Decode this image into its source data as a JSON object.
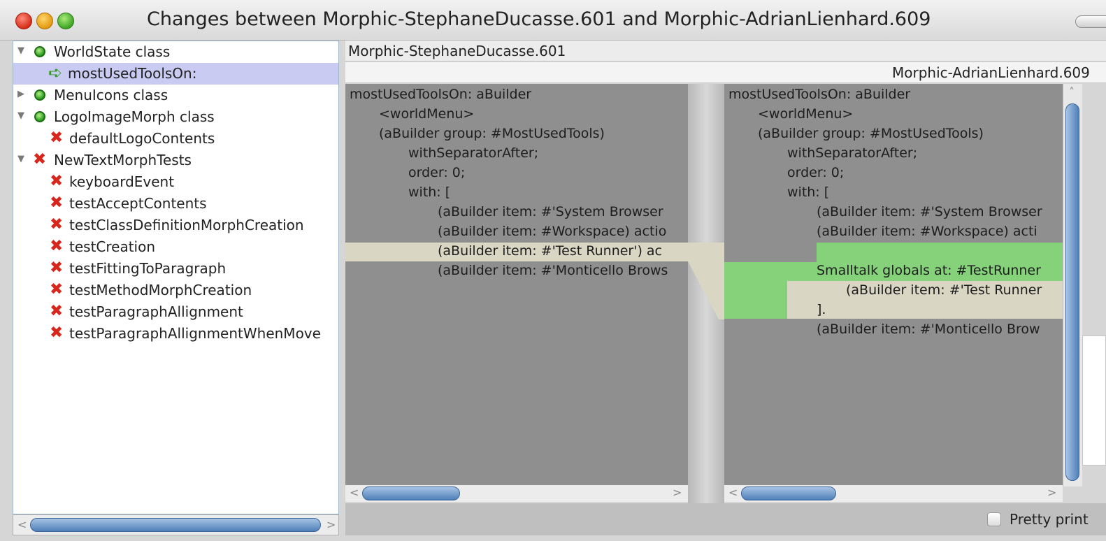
{
  "window": {
    "title": "Changes between Morphic-StephaneDucasse.601 and Morphic-AdrianLienhard.609"
  },
  "tree": {
    "items": [
      {
        "label": "WorldState class",
        "status": "ok",
        "expanded": true
      },
      {
        "label": "mostUsedToolsOn:",
        "status": "changed",
        "selected": true
      },
      {
        "label": "MenuIcons class",
        "status": "ok",
        "expanded": false
      },
      {
        "label": "LogoImageMorph class",
        "status": "ok",
        "expanded": true
      },
      {
        "label": "defaultLogoContents",
        "status": "removed"
      },
      {
        "label": "NewTextMorphTests",
        "status": "removed",
        "expanded": true
      },
      {
        "label": "keyboardEvent",
        "status": "removed"
      },
      {
        "label": "testAcceptContents",
        "status": "removed"
      },
      {
        "label": "testClassDefinitionMorphCreation",
        "status": "removed"
      },
      {
        "label": "testCreation",
        "status": "removed"
      },
      {
        "label": "testFittingToParagraph",
        "status": "removed"
      },
      {
        "label": "testMethodMorphCreation",
        "status": "removed"
      },
      {
        "label": "testParagraphAllignment",
        "status": "removed"
      },
      {
        "label": "testParagraphAllignmentWhenMove",
        "status": "removed"
      }
    ]
  },
  "diff": {
    "left_header": "Morphic-StephaneDucasse.601",
    "right_header": "Morphic-AdrianLienhard.609",
    "left_lines": [
      "mostUsedToolsOn: aBuilder",
      "<worldMenu>",
      "(aBuilder group: #MostUsedTools)",
      "withSeparatorAfter;",
      "order: 0;",
      "with: [",
      "(aBuilder item: #'System Browser",
      "(aBuilder item: #Workspace) actio",
      "(aBuilder item: #'Test Runner') ac",
      "(aBuilder item: #'Monticello Brows"
    ],
    "right_lines": [
      "mostUsedToolsOn: aBuilder",
      "<worldMenu>",
      "(aBuilder group: #MostUsedTools)",
      "withSeparatorAfter;",
      "order: 0;",
      "with: [",
      "(aBuilder item: #'System Browser",
      "(aBuilder item: #Workspace) acti",
      "Smalltalk globals at: #TestRunner",
      "(aBuilder item: #'Test Runner",
      "].",
      "(aBuilder item: #'Monticello Brow"
    ]
  },
  "footer": {
    "pretty_print_label": "Pretty print",
    "pretty_print_checked": false
  },
  "colors": {
    "selection": "#c9cbf3",
    "diff_added": "#85d27b",
    "diff_changed": "#d9d7c3",
    "pane_bg": "#8f8f8f"
  }
}
